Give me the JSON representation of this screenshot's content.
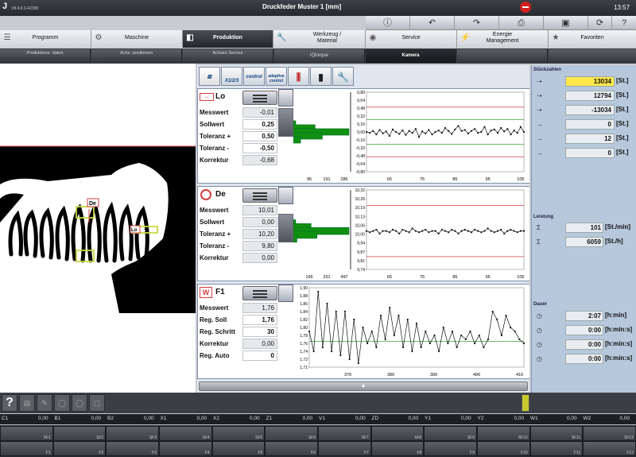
{
  "app": {
    "logo": "J",
    "version": "V8.4.0.0-42399",
    "title": "Druckfeder  Muster  1 [mm]",
    "clock": "13:57"
  },
  "toolbar": {
    "icons": [
      "info-icon",
      "undo-icon",
      "redo-icon",
      "printer-icon",
      "save-icon",
      "refresh-icon",
      "help-icon"
    ]
  },
  "main_tabs": [
    {
      "label": "Programm",
      "icon": "list-icon"
    },
    {
      "label": "Maschine",
      "icon": "gears-icon"
    },
    {
      "label": "Produktion",
      "icon": "production-icon",
      "active": true
    },
    {
      "label": "Werkzeug / Material",
      "icon": "wrench-icon"
    },
    {
      "label": "Service",
      "icon": "eye-icon"
    },
    {
      "label": "Energie Management",
      "icon": "energy-icon"
    },
    {
      "label": "Favoriten",
      "icon": "star-icon"
    }
  ],
  "sub_tabs": [
    {
      "label": "Produktions- daten"
    },
    {
      "label": "Achs- positionen"
    },
    {
      "label": "Achsen Service"
    },
    {
      "label": "iQtorque"
    },
    {
      "label": "Kamera",
      "active": true
    },
    {
      "label": ""
    },
    {
      "label": ""
    }
  ],
  "center_tools": {
    "multi_label": "X1/2/3",
    "control_label": "control",
    "adaptive_label": "adaptive control"
  },
  "panels": [
    {
      "name": "Lo",
      "rows": [
        {
          "label": "Messwert",
          "value": "-0,01"
        },
        {
          "label": "Sollwert",
          "value": "0,25"
        },
        {
          "label": "Toleranz +",
          "value": "0,50"
        },
        {
          "label": "Toleranz -",
          "value": "-0,50"
        },
        {
          "label": "Korrektur",
          "value": "-0,68"
        }
      ]
    },
    {
      "name": "De",
      "rows": [
        {
          "label": "Messwert",
          "value": "10,01"
        },
        {
          "label": "Sollwert",
          "value": "0,00"
        },
        {
          "label": "Toleranz +",
          "value": "10,20"
        },
        {
          "label": "Toleranz -",
          "value": "9,80"
        },
        {
          "label": "Korrektur",
          "value": "0,00"
        }
      ]
    },
    {
      "name": "F1",
      "rows": [
        {
          "label": "Messwert",
          "value": "1,76"
        },
        {
          "label": "Reg. Soll",
          "value": "1,76"
        },
        {
          "label": "Reg. Schritt",
          "value": "30"
        },
        {
          "label": "Korrektur",
          "value": "0,00"
        },
        {
          "label": "Reg. Auto",
          "value": "0"
        }
      ]
    }
  ],
  "chart_data": [
    {
      "type": "line",
      "name": "Lo",
      "y_ticks": [
        "0,80",
        "0,64",
        "0,48",
        "0,32",
        "0,16",
        "0,00",
        "-0,16",
        "-0,32",
        "-0,48",
        "-0,64",
        "-0,80"
      ],
      "x_ticks": [
        "65",
        "75",
        "85",
        "95",
        "105"
      ],
      "hist_x_ticks": [
        "95",
        "191",
        "286"
      ],
      "ylim": [
        -0.8,
        0.8
      ],
      "xlim": [
        58,
        106
      ],
      "tolerance_upper": 0.5,
      "tolerance_lower": -0.5,
      "target": 0.25,
      "target2": -0.25,
      "hist": [
        {
          "y": 0.16,
          "count": 10
        },
        {
          "y": 0.08,
          "count": 90
        },
        {
          "y": 0.0,
          "count": 230
        },
        {
          "y": -0.08,
          "count": 120
        },
        {
          "y": -0.16,
          "count": 30
        }
      ],
      "values": [
        0.0,
        -0.02,
        0.02,
        -0.05,
        0.04,
        -0.03,
        0.01,
        -0.08,
        0.05,
        0.0,
        -0.04,
        0.03,
        -0.06,
        0.02,
        -0.02,
        0.06,
        -0.1,
        0.01,
        -0.03,
        0.04,
        -0.05,
        0.0,
        0.03,
        -0.02,
        0.08,
        0.02,
        -0.04,
        0.05,
        0.12,
        0.02,
        0.04,
        -0.03,
        0.02,
        0.06,
        -0.02,
        0.0,
        0.1,
        -0.05,
        0.03,
        0.05,
        -0.02,
        0.08,
        0.01,
        0.06,
        -0.05,
        0.03,
        -0.02,
        0.1,
        0.0
      ]
    },
    {
      "type": "line",
      "name": "De",
      "y_ticks": [
        "10,32",
        "10,26",
        "10,19",
        "10,13",
        "10,06",
        "10,00",
        "9,94",
        "9,87",
        "9,81",
        "9,74"
      ],
      "x_ticks": [
        "65",
        "75",
        "85",
        "95",
        "105"
      ],
      "hist_x_ticks": [
        "166",
        "331",
        "497"
      ],
      "ylim": [
        9.7,
        10.32
      ],
      "xlim": [
        58,
        106
      ],
      "tolerance_upper": 10.2,
      "tolerance_lower": 9.8,
      "hist": [
        {
          "y": 10.06,
          "count": 20
        },
        {
          "y": 10.03,
          "count": 150
        },
        {
          "y": 10.0,
          "count": 470
        },
        {
          "y": 9.97,
          "count": 200
        },
        {
          "y": 9.94,
          "count": 30
        }
      ],
      "values": [
        10.0,
        9.99,
        10.0,
        10.01,
        9.98,
        10.0,
        10.0,
        9.99,
        10.01,
        10.0,
        9.98,
        10.01,
        10.0,
        9.99,
        10.02,
        10.0,
        9.99,
        10.0,
        10.01,
        9.99,
        10.0,
        10.0,
        9.98,
        10.01,
        10.0,
        9.99,
        10.01,
        10.0,
        9.98,
        10.0,
        10.01,
        10.0,
        9.99,
        10.01,
        10.0,
        9.99,
        10.0,
        10.02,
        10.0,
        9.99,
        10.0,
        10.01,
        9.98,
        10.0,
        10.01,
        10.0,
        9.99,
        10.0,
        10.0
      ]
    },
    {
      "type": "line",
      "name": "F1",
      "y_ticks": [
        "1,90",
        "1,88",
        "1,86",
        "1,84",
        "1,82",
        "1,80",
        "1,78",
        "1,76",
        "1,74",
        "1,72",
        "1,71"
      ],
      "x_ticks": [
        "376",
        "386",
        "396",
        "406",
        "416"
      ],
      "ylim": [
        1.7,
        1.9
      ],
      "xlim": [
        367,
        417
      ],
      "target": 1.765,
      "values": [
        1.79,
        1.74,
        1.89,
        1.75,
        1.86,
        1.74,
        1.84,
        1.73,
        1.84,
        1.72,
        1.82,
        1.71,
        1.8,
        1.76,
        1.79,
        1.75,
        1.83,
        1.77,
        1.85,
        1.78,
        1.83,
        1.75,
        1.82,
        1.74,
        1.81,
        1.75,
        1.79,
        1.76,
        1.78,
        1.74,
        1.8,
        1.76,
        1.79,
        1.75,
        1.78,
        1.77,
        1.79,
        1.76,
        1.78,
        1.75,
        1.77,
        1.84,
        1.82,
        1.78,
        1.83,
        1.8,
        1.79,
        1.77,
        1.76
      ]
    }
  ],
  "right_panel": {
    "counts_title": "Stückzahlen",
    "counts": [
      {
        "icon": "target-count-icon",
        "value": "13034",
        "unit": "[St.]",
        "highlight": true
      },
      {
        "icon": "produced-count-icon",
        "value": "12794",
        "unit": "[St.]"
      },
      {
        "icon": "remaining-count-icon",
        "value": "-13034",
        "unit": "[St.]"
      },
      {
        "icon": "batch-count-icon",
        "value": "0",
        "unit": "[St.]"
      },
      {
        "icon": "good-bin-icon",
        "value": "12",
        "unit": "[St.]"
      },
      {
        "icon": "bad-bin-icon",
        "value": "0",
        "unit": "[St.]"
      }
    ],
    "perf_title": "Leistung",
    "perf": [
      {
        "icon": "rate-min-icon",
        "value": "101",
        "unit": "[St./min]"
      },
      {
        "icon": "rate-hour-icon",
        "value": "6059",
        "unit": "[St./h]"
      }
    ],
    "dur_title": "Dauer",
    "dur": [
      {
        "icon": "clock-total-icon",
        "value": "2:07",
        "unit": "[h:min]"
      },
      {
        "icon": "clock-run-icon",
        "value": "0:00",
        "unit": "[h:min:s]"
      },
      {
        "icon": "clock-batch-icon",
        "value": "0:00",
        "unit": "[h:min:s]"
      },
      {
        "icon": "clock-idle-icon",
        "value": "0:00",
        "unit": "[h:min:s]"
      }
    ]
  },
  "camera": {
    "label_de": "De",
    "label_lo": "Lo"
  },
  "help": {
    "label": "?"
  },
  "axes": [
    {
      "name": "C1",
      "value": "0,00"
    },
    {
      "name": "B1",
      "value": "0,00"
    },
    {
      "name": "B2",
      "value": "0,00"
    },
    {
      "name": "X1",
      "value": "0,00"
    },
    {
      "name": "X2",
      "value": "0,00"
    },
    {
      "name": "Z1",
      "value": "0,00"
    },
    {
      "name": "V1",
      "value": "0,00"
    },
    {
      "name": "ZD",
      "value": "0,00"
    },
    {
      "name": "Y1",
      "value": "0,00"
    },
    {
      "name": "Y2",
      "value": "0,00"
    },
    {
      "name": "W1",
      "value": "0,00"
    },
    {
      "name": "W2",
      "value": "0,00"
    }
  ],
  "sf_keys": [
    "SF1",
    "SF2",
    "SF3",
    "SF4",
    "SF5",
    "SF6",
    "SF7",
    "SF8",
    "SF9",
    "SF10",
    "SF11",
    "SF12"
  ],
  "f_keys": [
    "F1",
    "F2",
    "F3",
    "F4",
    "F5",
    "F6",
    "F7",
    "F8",
    "F9",
    "F10",
    "F11",
    "F12"
  ],
  "colors": {
    "tolerance": "#d04040",
    "target": "#40a040",
    "hist": "#109010",
    "highlight": "#ffe84a"
  }
}
